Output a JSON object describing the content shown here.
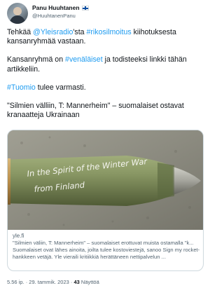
{
  "author": {
    "display_name": "Panu Huuhtanen",
    "handle": "@HuuhtanenPanu",
    "verified_flag_icon": "finland-flag-icon"
  },
  "tweet": {
    "line1_before": "Tehkää ",
    "line1_mention": "@Yleisradio",
    "line1_mid": "'sta ",
    "line1_hashtag": "#rikosilmoitus",
    "line1_after": " kiihotuksesta kansanryhmää vastaan.",
    "line2_before": "Kansanryhmä on ",
    "line2_hashtag": "#venäläiset",
    "line2_after": " ja todisteeksi linkki tähän artikkeliin.",
    "line3_hashtag": "#Tuomio",
    "line3_after": " tulee varmasti.",
    "line4": "\"Silmien välliin, T: Mannerheim\" – suomalaiset ostavat kranaatteja Ukrainaan"
  },
  "card": {
    "image_text_line1": "In the Spirit of the Winter War",
    "image_text_line2": "from Finland",
    "domain": "yle.fi",
    "title": "\"Silmien väliin, T: Mannerheim\" – suomalaiset erottuvat muista ostamalla \"k...",
    "description": "Suomalaiset ovat lähes ainoita, joilta tulee kostoviestejä, sanoo Sign my rocket-hankkeen vetäjä. Yle vieraili kritiikkiä herättäneen nettipalvelun ..."
  },
  "footer": {
    "time": "5.56 ip.",
    "separator": " · ",
    "date": "29. tammik. 2023",
    "views_count": "43",
    "views_label": " Näyttöä"
  },
  "colors": {
    "link": "#1d9bf0",
    "text": "#0f1419",
    "secondary": "#536471",
    "border": "#cfd9de",
    "shell": "#7d8a5b"
  }
}
